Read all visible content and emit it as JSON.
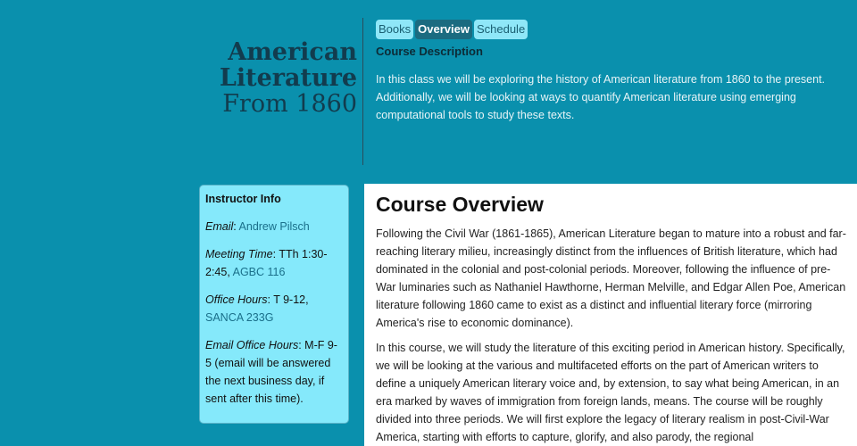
{
  "site": {
    "title_line1": "American",
    "title_line2": "Literature",
    "title_line3": "From 1860"
  },
  "nav": {
    "tabs": [
      {
        "label": "Books",
        "active": false
      },
      {
        "label": "Overview",
        "active": true
      },
      {
        "label": "Schedule",
        "active": false
      }
    ]
  },
  "description": {
    "heading": "Course Description",
    "text": "In this class we will be exploring the history of American literature from 1860 to the present. Additionally, we will be looking at ways to quantify American literature using emerging computational tools to study these texts."
  },
  "sidebar": {
    "heading": "Instructor Info",
    "email_label": "Email",
    "email_value": "Andrew Pilsch",
    "meeting_label": "Meeting Time",
    "meeting_value": "TTh 1:30-2:45,",
    "meeting_location": "AGBC 116",
    "office_label": "Office Hours",
    "office_value": "T 9-12,",
    "office_location": "SANCA 233G",
    "email_hours_label": "Email Office Hours",
    "email_hours_value": "M-F 9-5 (email will be answered the next business day, if sent after this time)."
  },
  "main": {
    "heading": "Course Overview",
    "paragraph1": "Following the Civil War (1861-1865), American Literature began to mature into a robust and far-reaching literary milieu, increasingly distinct from the influences of British literature, which had dominated in the colonial and post-colonial periods. Moreover, following the influence of pre-War luminaries such as Nathaniel Hawthorne, Herman Melville, and Edgar Allen Poe, American literature following 1860 came to exist as a distinct and influential literary force (mirroring America's rise to economic dominance).",
    "paragraph2": "In this course, we will study the literature of this exciting period in American history. Specifically, we will be looking at the various and multifaceted efforts on the part of American writers to define a uniquely American literary voice and, by extension, to say what being American, in an era marked by waves of immigration from foreign lands, means. The course will be roughly divided into three periods. We will first explore the legacy of literary realism in post-Civil-War America, starting with efforts to capture, glorify, and also parody, the regional"
  }
}
